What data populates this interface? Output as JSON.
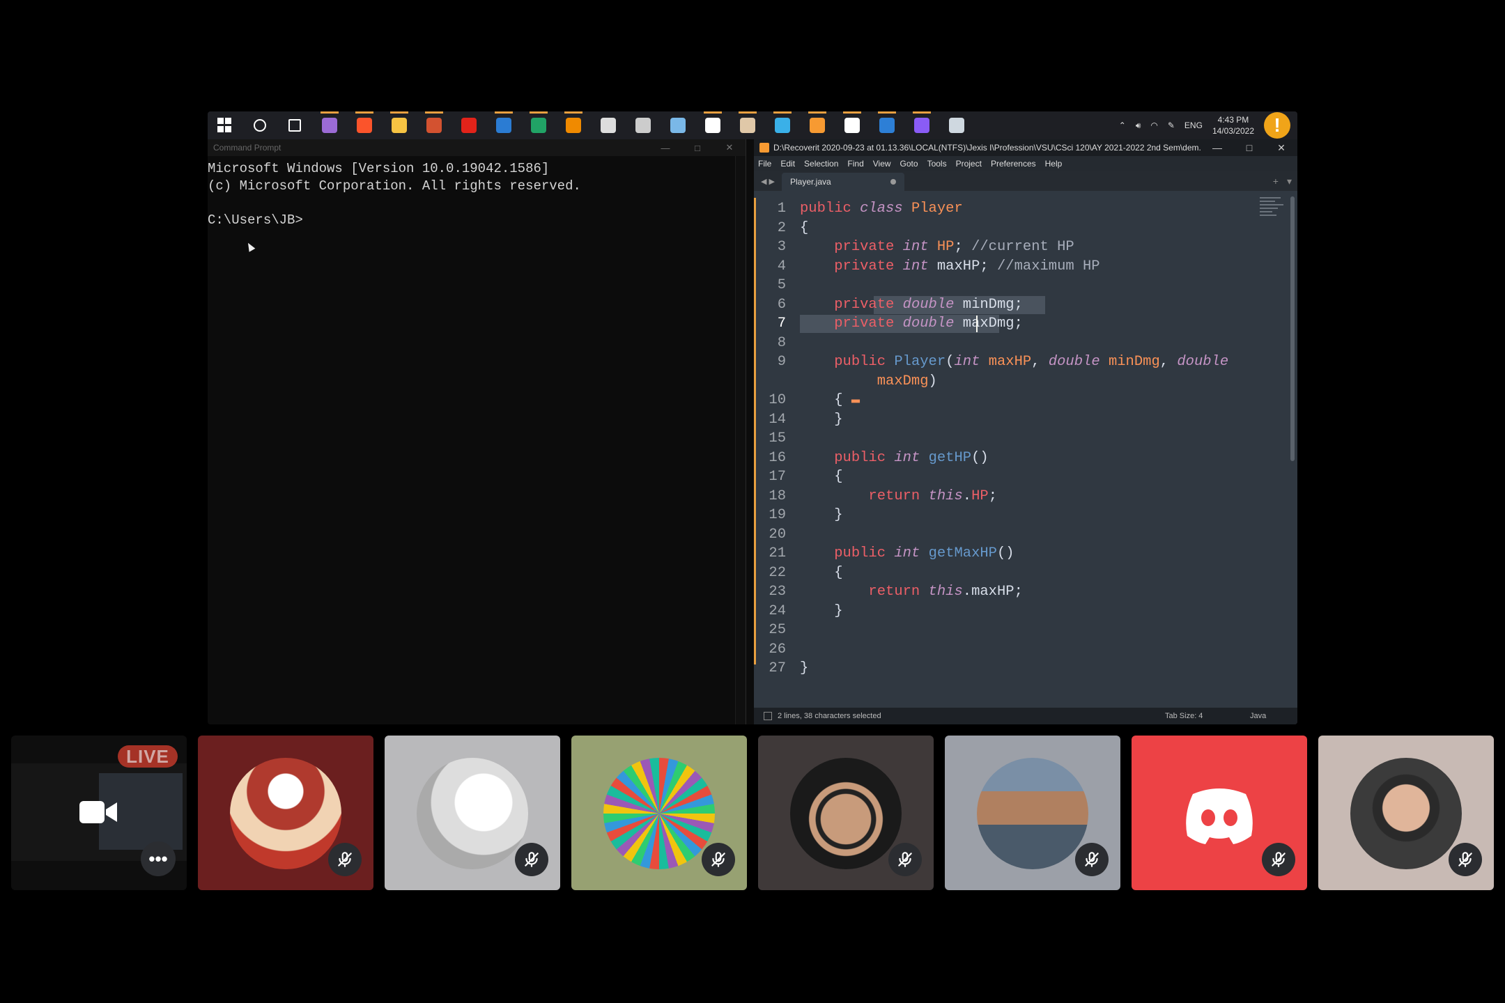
{
  "taskbar": {
    "apps": [
      {
        "name": "search-icon",
        "color": "#ffffff"
      },
      {
        "name": "task-view-icon",
        "color": "#ffffff"
      },
      {
        "name": "visual-studio-icon",
        "color": "#9b6bd6"
      },
      {
        "name": "brave-icon",
        "color": "#fb542b"
      },
      {
        "name": "file-explorer-icon",
        "color": "#f6c343"
      },
      {
        "name": "powerpoint-icon",
        "color": "#d35230"
      },
      {
        "name": "acrobat-icon",
        "color": "#e2231a"
      },
      {
        "name": "word-icon",
        "color": "#2b7cd3"
      },
      {
        "name": "excel-icon",
        "color": "#21a366"
      },
      {
        "name": "vlc-icon",
        "color": "#f08a00"
      },
      {
        "name": "music-app-icon",
        "color": "#dddddd"
      },
      {
        "name": "media-app-icon",
        "color": "#cccccc"
      },
      {
        "name": "tablet-app-icon",
        "color": "#7ab8e8"
      },
      {
        "name": "notion-icon",
        "color": "#ffffff"
      },
      {
        "name": "photos-app-icon",
        "color": "#e0c8a8"
      },
      {
        "name": "edge-icon",
        "color": "#3ab0e8"
      },
      {
        "name": "sublime-text-icon",
        "color": "#f79a32"
      },
      {
        "name": "terminal-icon",
        "color": "#ffffff"
      },
      {
        "name": "stocks-app-icon",
        "color": "#2d7fd6"
      },
      {
        "name": "messenger-icon",
        "color": "#8a5cf6"
      },
      {
        "name": "remote-desktop-icon",
        "color": "#cfd8e0"
      }
    ],
    "tray": {
      "language": "ENG",
      "time": "4:43 PM",
      "date": "14/03/2022",
      "warning_symbol": "!"
    }
  },
  "cmd": {
    "title": "Command Prompt",
    "lines": [
      "Microsoft Windows [Version 10.0.19042.1586]",
      "(c) Microsoft Corporation. All rights reserved.",
      "",
      "C:\\Users\\JB>"
    ]
  },
  "sublime": {
    "title": "D:\\Recoverit 2020-09-23 at 01.13.36\\LOCAL(NTFS)\\Jexis I\\Profession\\VSU\\CSci 120\\AY 2021-2022 2nd Sem\\dem...",
    "menu": [
      "File",
      "Edit",
      "Selection",
      "Find",
      "View",
      "Goto",
      "Tools",
      "Project",
      "Preferences",
      "Help"
    ],
    "tab": "Player.java",
    "line_numbers": [
      "1",
      "2",
      "3",
      "4",
      "5",
      "6",
      "7",
      "8",
      "9",
      "",
      "10",
      "14",
      "15",
      "16",
      "17",
      "18",
      "19",
      "20",
      "21",
      "22",
      "23",
      "24",
      "25",
      "26",
      "27"
    ],
    "status": {
      "selection": "2 lines, 38 characters selected",
      "tab_size": "Tab Size: 4",
      "syntax": "Java"
    }
  },
  "participants": {
    "live_label": "LIVE",
    "more_label": "•••",
    "tiles": [
      {
        "name": "stream-preview",
        "bg": "#0e0e0e"
      },
      {
        "name": "pirate-avatar",
        "bg": "#6b1f1f"
      },
      {
        "name": "meme-avatar",
        "bg": "#b9b9bb"
      },
      {
        "name": "pixel-avatar",
        "bg": "#97a172"
      },
      {
        "name": "masked-avatar",
        "bg": "#3f3939"
      },
      {
        "name": "suit-avatar",
        "bg": "#9ca0a8"
      },
      {
        "name": "discord-avatar",
        "bg": "#ed4245"
      },
      {
        "name": "headset-avatar",
        "bg": "#c8bab4"
      }
    ]
  }
}
